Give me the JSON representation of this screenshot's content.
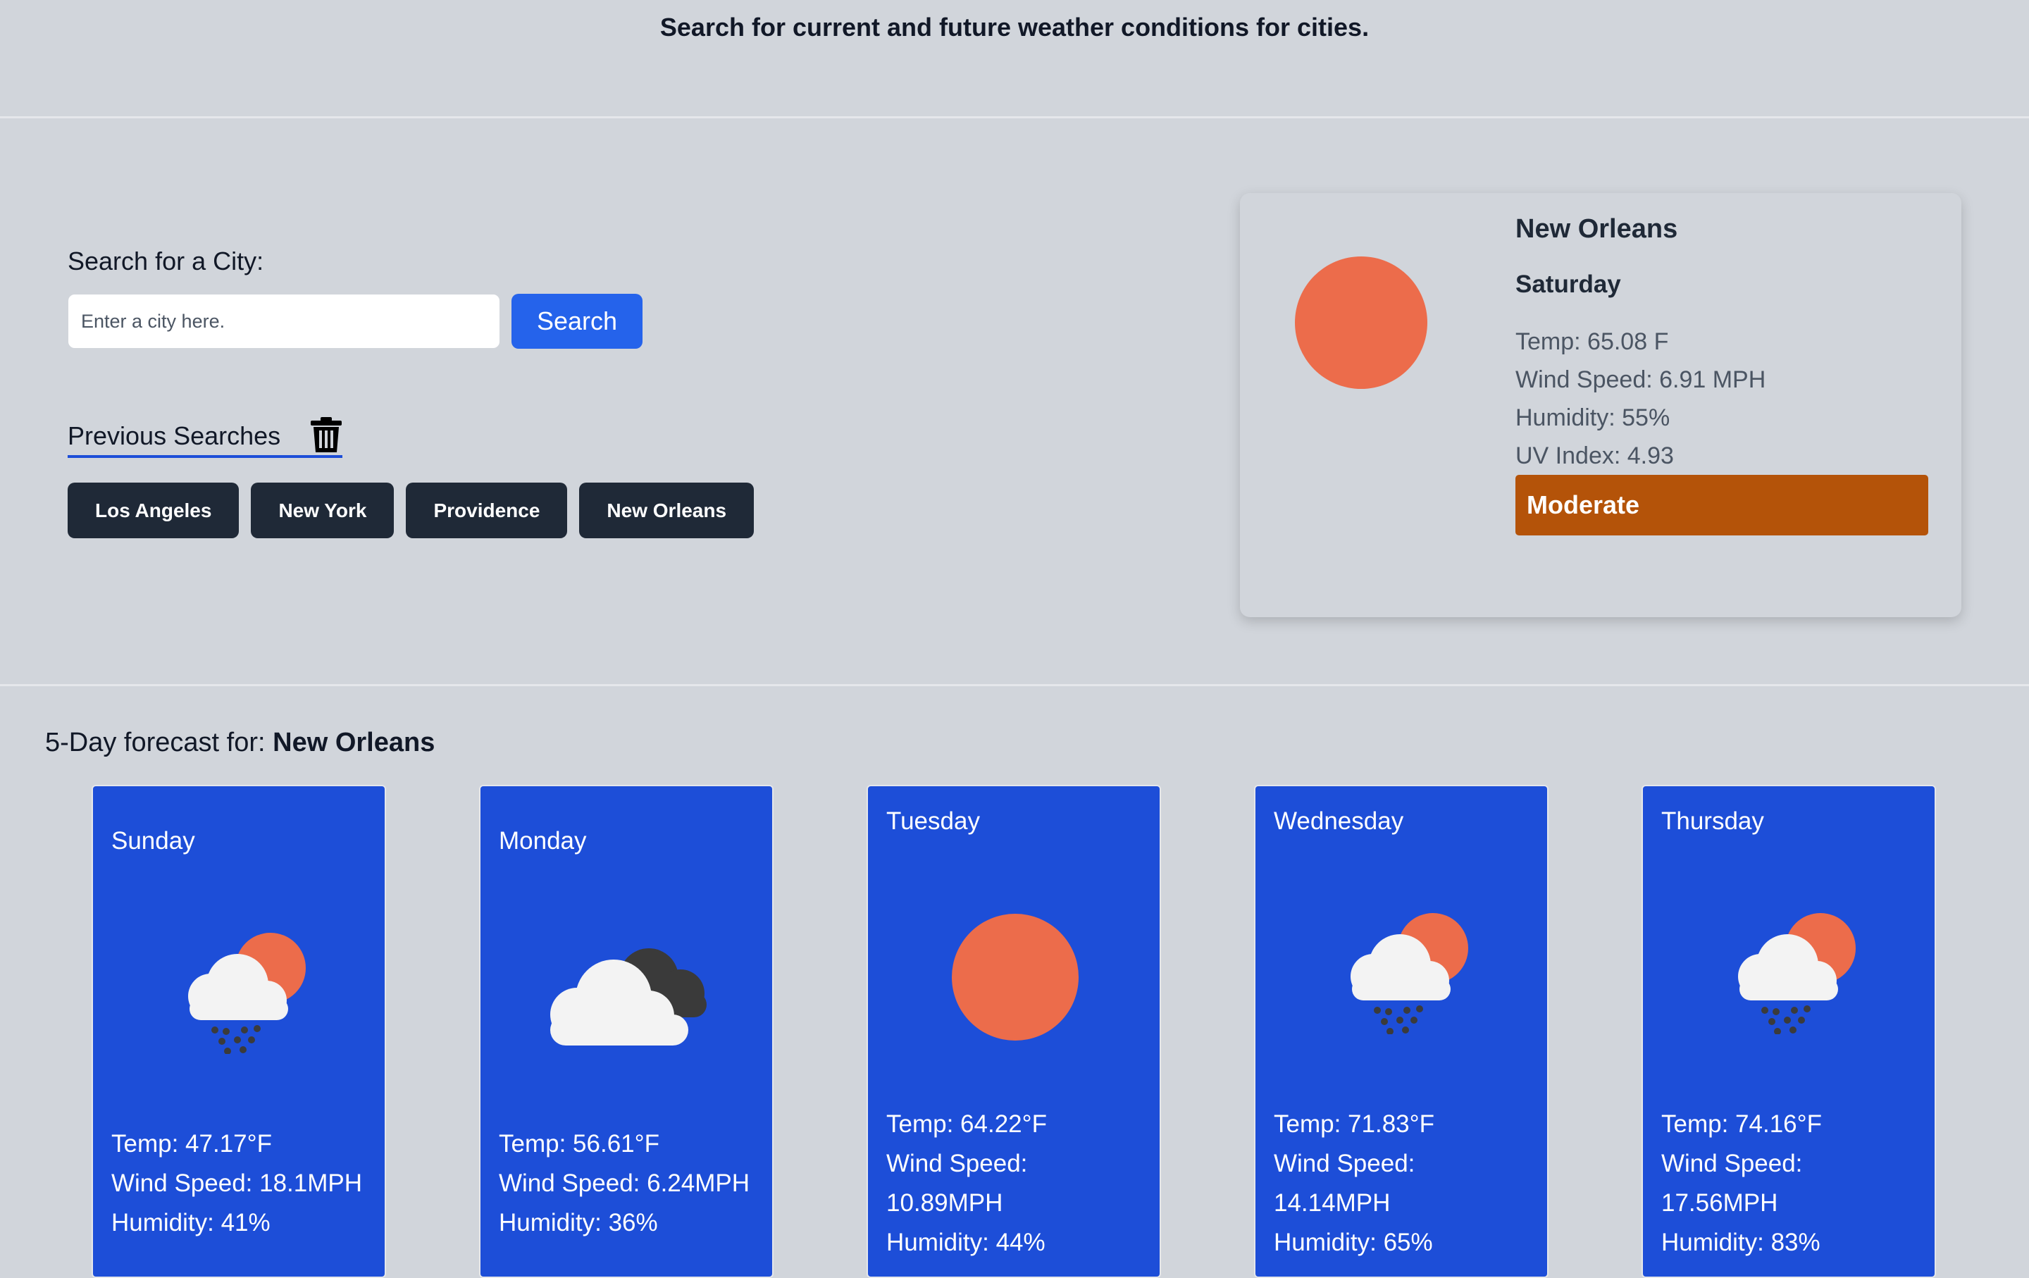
{
  "header": {
    "tagline": "Search for current and future weather conditions for cities."
  },
  "search": {
    "label": "Search for a City:",
    "placeholder": "Enter a city here.",
    "value": "",
    "button_label": "Search"
  },
  "history": {
    "label": "Previous Searches",
    "clear_icon": "trash-icon",
    "cities": [
      "Los Angeles",
      "New York",
      "Providence",
      "New Orleans"
    ]
  },
  "current": {
    "city": "New Orleans",
    "day": "Saturday",
    "icon": "sun-icon",
    "temp": "Temp: 65.08 F",
    "wind": "Wind Speed: 6.91 MPH",
    "humidity": "Humidity: 55%",
    "uv": "UV Index: 4.93",
    "uv_level": "Moderate",
    "uv_color": "#b45309"
  },
  "forecast": {
    "heading_prefix": "5-Day forecast for:",
    "city": "New Orleans",
    "days": [
      {
        "day": "Sunday",
        "icon": "rain-sun-icon",
        "temp": "Temp: 47.17°F",
        "wind": "Wind Speed: 18.1MPH",
        "humidity": "Humidity: 41%"
      },
      {
        "day": "Monday",
        "icon": "cloudy-icon",
        "temp": "Temp: 56.61°F",
        "wind": "Wind Speed: 6.24MPH",
        "humidity": "Humidity: 36%"
      },
      {
        "day": "Tuesday",
        "icon": "sun-icon",
        "temp": "Temp: 64.22°F",
        "wind": "Wind Speed: 10.89MPH",
        "humidity": "Humidity: 44%"
      },
      {
        "day": "Wednesday",
        "icon": "rain-sun-icon",
        "temp": "Temp: 71.83°F",
        "wind": "Wind Speed: 14.14MPH",
        "humidity": "Humidity: 65%"
      },
      {
        "day": "Thursday",
        "icon": "rain-sun-icon",
        "temp": "Temp: 74.16°F",
        "wind": "Wind Speed: 17.56MPH",
        "humidity": "Humidity: 83%"
      }
    ]
  },
  "colors": {
    "page_bg": "#d1d5db",
    "accent": "#2563eb",
    "card_blue": "#1d4ed8",
    "chip_bg": "#1f2937",
    "sun": "#ec6c4b"
  }
}
